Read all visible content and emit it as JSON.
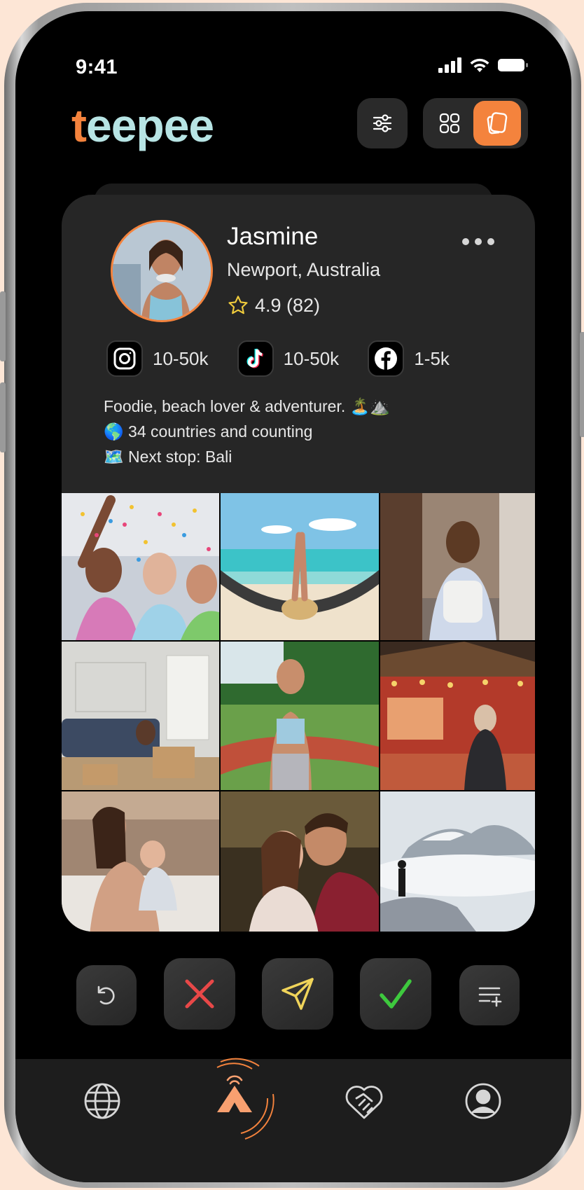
{
  "status_bar": {
    "time": "9:41"
  },
  "header": {
    "logo_first": "t",
    "logo_rest": "eepee",
    "filter_icon": "sliders-icon",
    "view_grid_icon": "grid-icon",
    "view_card_icon": "cards-icon",
    "active_view": "cards"
  },
  "profile": {
    "name": "Jasmine",
    "location": "Newport, Australia",
    "rating": "4.9 (82)",
    "socials": [
      {
        "platform": "instagram",
        "icon": "instagram-icon",
        "count": "10-50k"
      },
      {
        "platform": "tiktok",
        "icon": "tiktok-icon",
        "count": "10-50k"
      },
      {
        "platform": "facebook",
        "icon": "facebook-icon",
        "count": "1-5k"
      }
    ],
    "bio": [
      "Foodie, beach lover & adventurer. 🏝️⛰️",
      "🌎 34 countries and counting",
      "🗺️ Next stop: Bali"
    ]
  },
  "photos": [
    "party-confetti-photo",
    "beach-hammock-photo",
    "street-backpack-photo",
    "living-room-photo",
    "jogging-photo",
    "christmas-market-photo",
    "mother-baby-photo",
    "couple-photo",
    "mountain-clouds-photo"
  ],
  "actions": [
    {
      "name": "undo-button",
      "icon": "undo-icon"
    },
    {
      "name": "reject-button",
      "icon": "close-icon",
      "color": "#e84848"
    },
    {
      "name": "send-button",
      "icon": "send-icon",
      "color": "#f0d45a"
    },
    {
      "name": "accept-button",
      "icon": "check-icon",
      "color": "#3ec93e"
    },
    {
      "name": "add-to-list-button",
      "icon": "playlist-add-icon"
    }
  ],
  "tabbar": [
    {
      "name": "tab-explore",
      "icon": "globe-icon"
    },
    {
      "name": "tab-home",
      "icon": "teepee-icon",
      "active": true
    },
    {
      "name": "tab-matches",
      "icon": "handshake-heart-icon"
    },
    {
      "name": "tab-profile",
      "icon": "user-icon"
    }
  ],
  "colors": {
    "accent": "#f4833d",
    "logo_secondary": "#b7e4e4",
    "background": "#000000",
    "card": "#262626"
  }
}
